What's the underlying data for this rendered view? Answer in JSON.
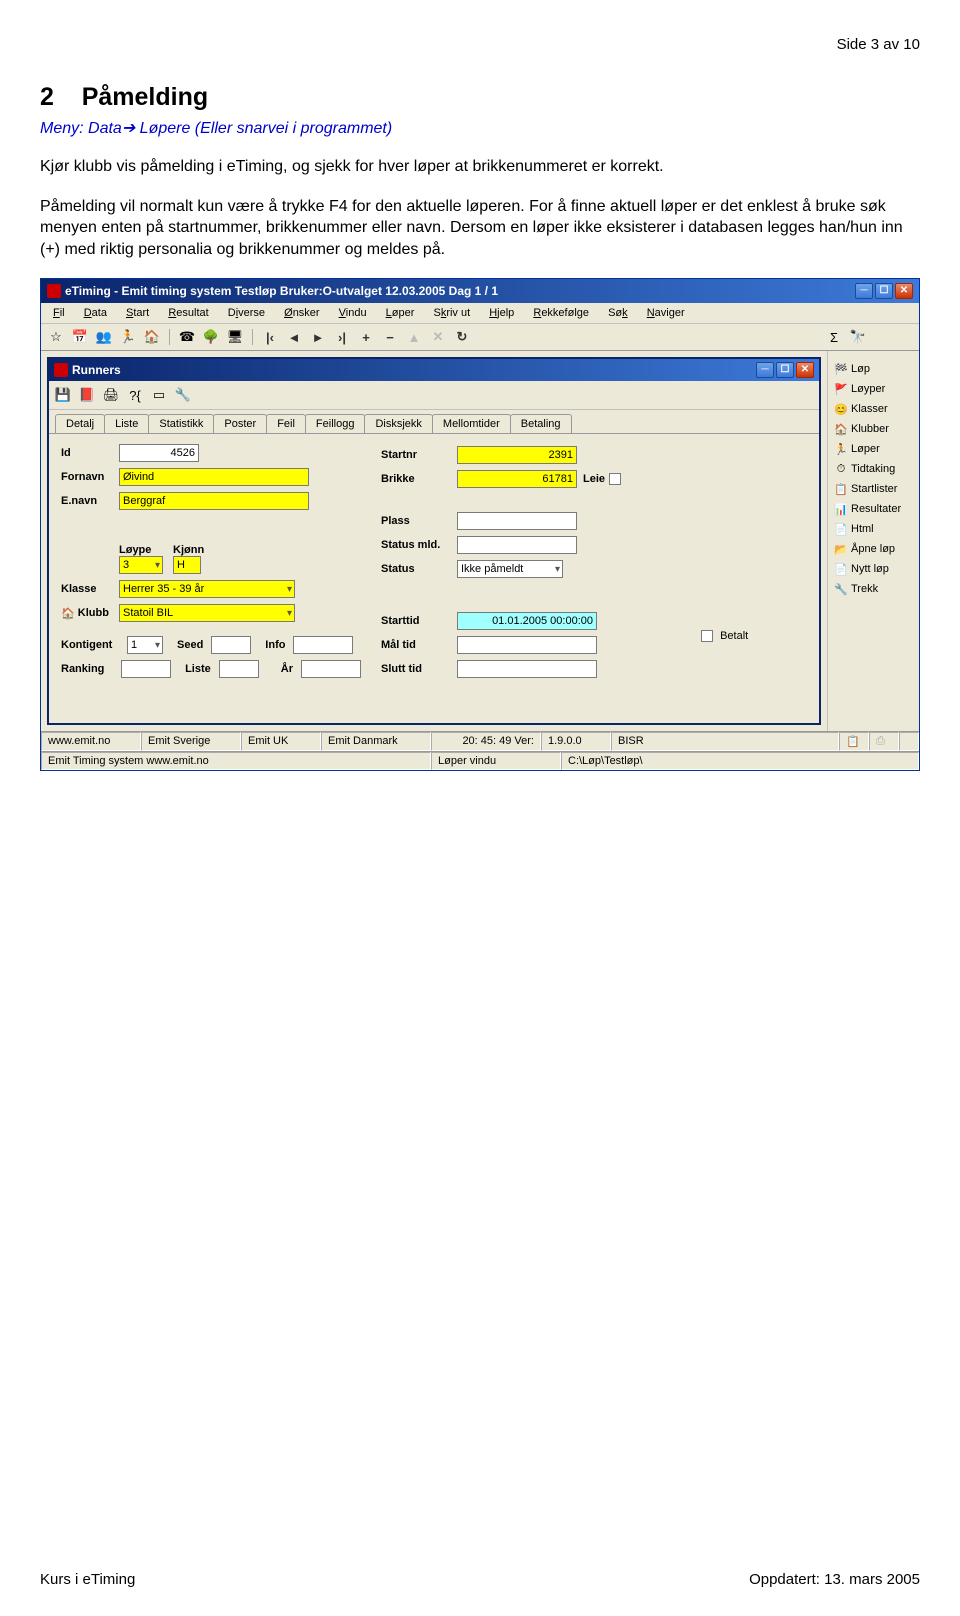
{
  "page_header": "Side 3 av 10",
  "section_number": "2",
  "section_title": "Påmelding",
  "menu_line_prefix": "Meny: Data",
  "menu_line_arrow": "→",
  "menu_line_suffix": " Løpere (Eller snarvei i programmet)",
  "paragraph1": "Kjør klubb vis påmelding i eTiming, og sjekk for hver løper at brikkenummeret er korrekt.",
  "paragraph2": "Påmelding vil normalt kun være å trykke F4 for den aktuelle løperen. For å finne aktuell løper er det enklest å bruke søk menyen enten på startnummer, brikkenummer eller navn. Dersom en løper ikke eksisterer i databasen legges han/hun inn (+) med riktig personalia og brikkenummer og meldes på.",
  "window": {
    "title": "eTiming - Emit timing system  Testløp  Bruker:O-utvalget  12.03.2005  Dag 1 / 1",
    "menus": [
      "Fil",
      "Data",
      "Start",
      "Resultat",
      "Diverse",
      "Ønsker",
      "Vindu",
      "Løper",
      "Skriv ut",
      "Hjelp",
      "Rekkefølge",
      "Søk",
      "Naviger"
    ],
    "sidebar": [
      {
        "icon": "🏁",
        "label": "Løp"
      },
      {
        "icon": "🚩",
        "label": "Løyper"
      },
      {
        "icon": "😊",
        "label": "Klasser"
      },
      {
        "icon": "🏠",
        "label": "Klubber"
      },
      {
        "icon": "🏃",
        "label": "Løper"
      },
      {
        "icon": "⏱",
        "label": "Tidtaking"
      },
      {
        "icon": "📋",
        "label": "Startlister"
      },
      {
        "icon": "📊",
        "label": "Resultater"
      },
      {
        "icon": "📄",
        "label": "Html"
      },
      {
        "icon": "📂",
        "label": "Åpne løp"
      },
      {
        "icon": "📄",
        "label": "Nytt løp"
      },
      {
        "icon": "🔧",
        "label": "Trekk"
      }
    ],
    "child_title": "Runners",
    "tabs": [
      "Detalj",
      "Liste",
      "Statistikk",
      "Poster",
      "Feil",
      "Feillogg",
      "Disksjekk",
      "Mellomtider",
      "Betaling"
    ],
    "form": {
      "id_label": "Id",
      "id_value": "4526",
      "fornavn_label": "Fornavn",
      "fornavn_value": "Øivind",
      "enavn_label": "E.navn",
      "enavn_value": "Berggraf",
      "startnr_label": "Startnr",
      "startnr_value": "2391",
      "brikke_label": "Brikke",
      "brikke_value": "61781",
      "leie_label": "Leie",
      "plass_label": "Plass",
      "statusmld_label": "Status mld.",
      "status_label": "Status",
      "status_value": "Ikke påmeldt",
      "loype_label": "Løype",
      "loype_value": "3",
      "kjonn_label": "Kjønn",
      "kjonn_value": "H",
      "klasse_label": "Klasse",
      "klasse_value": "Herrer 35 - 39 år",
      "klubb_label": "Klubb",
      "klubb_value": "Statoil BIL",
      "kontigent_label": "Kontigent",
      "kontigent_value": "1",
      "seed_label": "Seed",
      "info_label": "Info",
      "ranking_label": "Ranking",
      "liste_label": "Liste",
      "ar_label": "År",
      "starttid_label": "Starttid",
      "starttid_value": "01.01.2005 00:00:00",
      "maltid_label": "Mål tid",
      "slutttid_label": "Slutt tid",
      "betalt_label": "Betalt"
    },
    "status1": {
      "c1": "www.emit.no",
      "c2": "Emit Sverige",
      "c3": "Emit UK",
      "c4": "Emit Danmark",
      "c5": "20: 45: 49 Ver:",
      "c6": "1.9.0.0",
      "c7": "BISR"
    },
    "status2": {
      "c1": "Emit Timing system www.emit.no",
      "c2": "Løper vindu",
      "c3": "C:\\Løp\\Testløp\\"
    }
  },
  "footer_left": "Kurs i eTiming",
  "footer_right": "Oppdatert: 13. mars 2005"
}
